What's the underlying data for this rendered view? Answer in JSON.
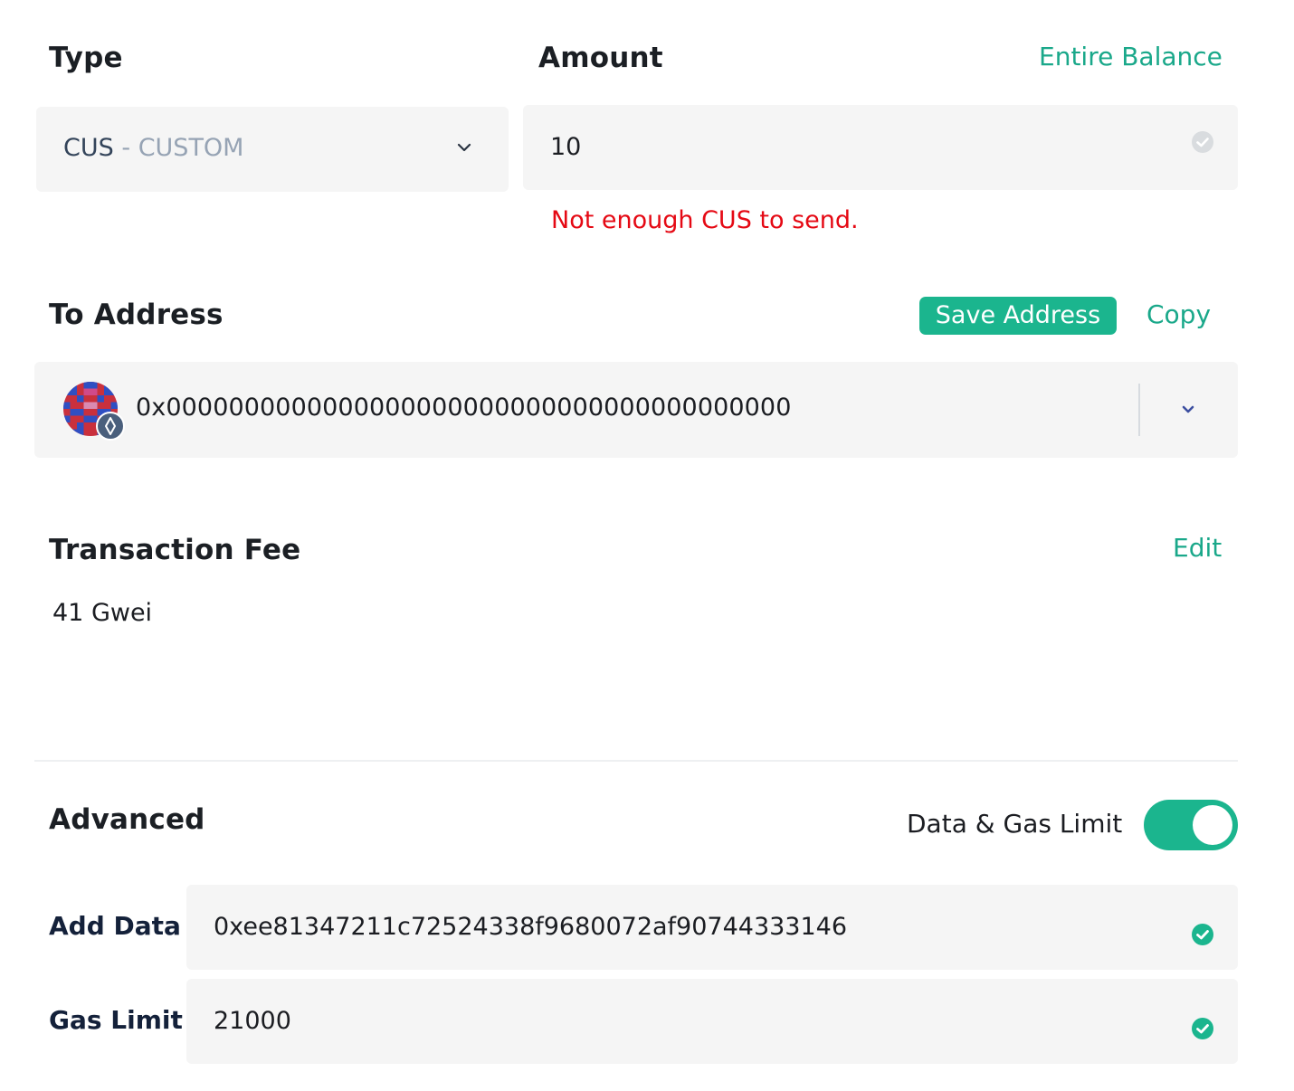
{
  "type_section": {
    "label": "Type",
    "selected_symbol": "CUS",
    "selected_separator": " - ",
    "selected_name": "CUSTOM"
  },
  "amount_section": {
    "label": "Amount",
    "entire_balance_link": "Entire Balance",
    "value": "10",
    "error": "Not enough CUS to send."
  },
  "to_address": {
    "label": "To Address",
    "save_button": "Save Address",
    "copy_link": "Copy",
    "value": "0x0000000000000000000000000000000000000000"
  },
  "transaction_fee": {
    "label": "Transaction Fee",
    "edit_link": "Edit",
    "value": "41 Gwei"
  },
  "advanced": {
    "label": "Advanced",
    "toggle_label": "Data & Gas Limit",
    "toggle_on": true,
    "data_label": "Add Data",
    "data_value": "0xee81347211c72524338f9680072af90744333146",
    "gas_label": "Gas Limit",
    "gas_value": "21000"
  },
  "colors": {
    "accent": "#1bb58e",
    "link": "#1aa88a",
    "error": "#e50914",
    "field_bg": "#f5f5f5"
  },
  "icons": {
    "type_chevron": "chevron-down-icon",
    "address_chevron": "chevron-down-icon",
    "amount_valid": "check-circle-icon",
    "data_valid": "check-circle-icon",
    "gas_valid": "check-circle-icon",
    "network_badge": "ethereum-icon"
  }
}
